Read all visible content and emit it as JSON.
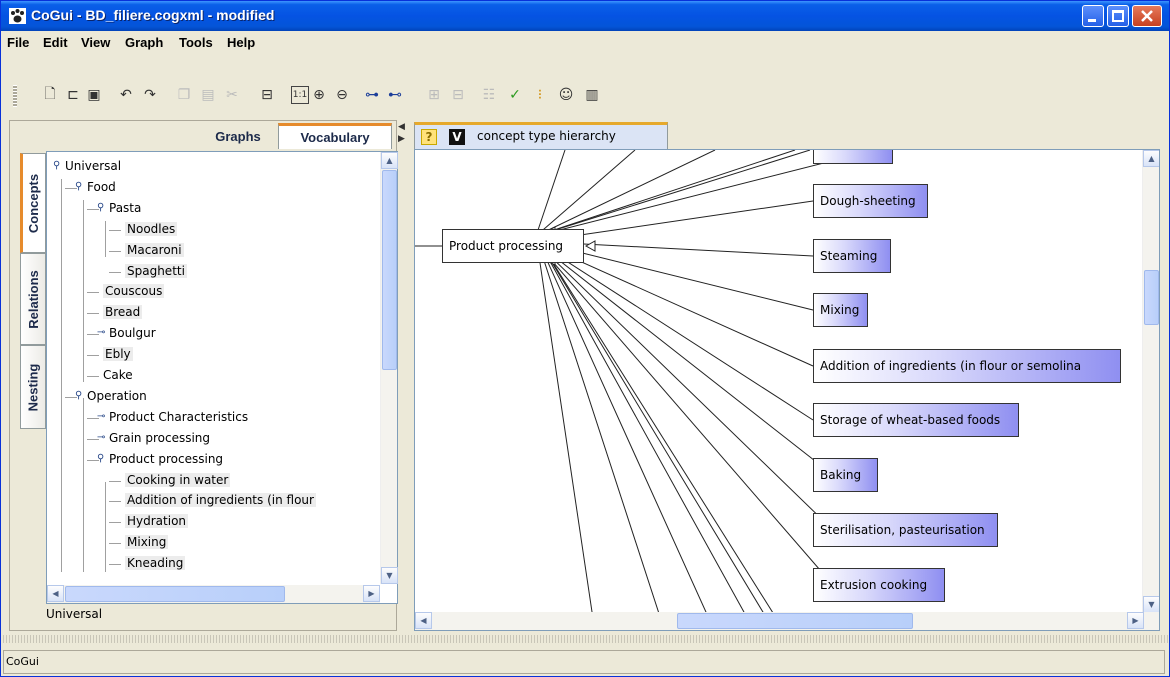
{
  "window": {
    "title": "CoGui - BD_filiere.cogxml - modified",
    "controls": [
      "minimize",
      "maximize",
      "close"
    ]
  },
  "menubar": [
    "File",
    "Edit",
    "View",
    "Graph",
    "Tools",
    "Help"
  ],
  "toolbar": {
    "icons": [
      "new-file-icon",
      "open-icon",
      "save-icon",
      "undo-icon",
      "redo-icon",
      "copy-icon",
      "paste-icon",
      "cut-icon",
      "layout-icon",
      "zoom-reset-icon",
      "zoom-in-icon",
      "zoom-out-icon",
      "tree-layout-icon",
      "hierarchy-layout-icon",
      "group-icon",
      "ungroup-icon",
      "align-icon",
      "check-icon",
      "traffic-light-icon",
      "comment-icon",
      "document-icon"
    ],
    "zoom_reset_label": "1:1"
  },
  "left_panel": {
    "tabs": [
      "Graphs",
      "Vocabulary"
    ],
    "active_tab": "Vocabulary",
    "side_tabs": [
      "Concepts",
      "Relations",
      "Nesting"
    ],
    "active_side_tab": "Concepts",
    "tree": [
      {
        "label": "Universal",
        "depth": 0,
        "expanded": true
      },
      {
        "label": "Food",
        "depth": 1,
        "expanded": true
      },
      {
        "label": "Pasta",
        "depth": 2,
        "expanded": true
      },
      {
        "label": "Noodles",
        "depth": 3,
        "leaf": true
      },
      {
        "label": "Macaroni",
        "depth": 3,
        "leaf": true
      },
      {
        "label": "Spaghetti",
        "depth": 3,
        "leaf": true
      },
      {
        "label": "Couscous",
        "depth": 2,
        "leaf": true
      },
      {
        "label": "Bread",
        "depth": 2,
        "leaf": true
      },
      {
        "label": "Boulgur",
        "depth": 2,
        "expanded": false
      },
      {
        "label": "Ebly",
        "depth": 2,
        "leaf": true
      },
      {
        "label": "Cake",
        "depth": 2,
        "leaf": true
      },
      {
        "label": "Operation",
        "depth": 1,
        "expanded": true
      },
      {
        "label": "Product Characteristics",
        "depth": 2,
        "expanded": false
      },
      {
        "label": "Grain processing",
        "depth": 2,
        "expanded": false
      },
      {
        "label": "Product processing",
        "depth": 2,
        "expanded": true
      },
      {
        "label": "Cooking in water",
        "depth": 3,
        "leaf": true
      },
      {
        "label": "Addition of ingredients (in flour",
        "depth": 3,
        "leaf": true
      },
      {
        "label": "Hydration",
        "depth": 3,
        "leaf": true
      },
      {
        "label": "Mixing",
        "depth": 3,
        "leaf": true
      },
      {
        "label": "Kneading",
        "depth": 3,
        "leaf": true
      }
    ],
    "status": "Universal"
  },
  "right_panel": {
    "tab_label": "concept type hierarchy",
    "tab_icons": [
      "help-icon",
      "vocabulary-icon"
    ],
    "tab_icon_text": {
      "help": "?",
      "vocab": "V"
    },
    "root_node": "Product processing",
    "child_nodes": [
      "Dough-sheeting",
      "Steaming",
      "Mixing",
      "Addition of ingredients (in flour or semolina",
      "Storage of wheat-based foods",
      "Baking",
      "Sterilisation, pasteurisation",
      "Extrusion cooking"
    ]
  },
  "statusbar": {
    "text": "CoGui"
  },
  "colors": {
    "titlebar": "#0553e3",
    "node_fill_end": "#8f8ff1",
    "tab_accent": "#e68b2c"
  }
}
